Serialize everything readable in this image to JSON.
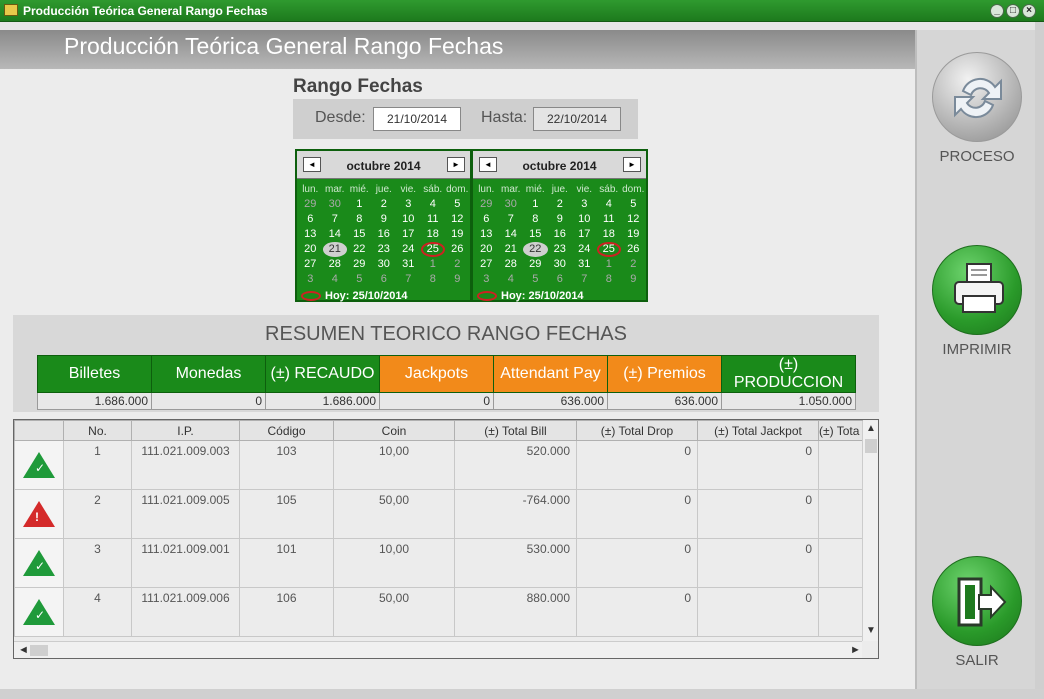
{
  "window": {
    "title": "Producción Teórica General Rango Fechas",
    "controls": [
      "_",
      "□",
      "×"
    ]
  },
  "header": {
    "title": "Producción Teórica General Rango Fechas"
  },
  "rango": {
    "title": "Rango Fechas",
    "desde_label": "Desde:",
    "desde_value": "21/10/2014",
    "hasta_label": "Hasta:",
    "hasta_value": "22/10/2014"
  },
  "calendars": [
    {
      "month": "octubre 2014",
      "prev": "◄",
      "next": "►",
      "day_headers": [
        "lun.",
        "mar.",
        "mié.",
        "jue.",
        "vie.",
        "sáb.",
        "dom."
      ],
      "weeks": [
        [
          "29",
          "30",
          "1",
          "2",
          "3",
          "4",
          "5"
        ],
        [
          "6",
          "7",
          "8",
          "9",
          "10",
          "11",
          "12"
        ],
        [
          "13",
          "14",
          "15",
          "16",
          "17",
          "18",
          "19"
        ],
        [
          "20",
          "21",
          "22",
          "23",
          "24",
          "25",
          "26"
        ],
        [
          "27",
          "28",
          "29",
          "30",
          "31",
          "1",
          "2"
        ],
        [
          "3",
          "4",
          "5",
          "6",
          "7",
          "8",
          "9"
        ]
      ],
      "selected": "21",
      "today_ring": "25",
      "footer": "Hoy: 25/10/2014"
    },
    {
      "month": "octubre 2014",
      "prev": "◄",
      "next": "►",
      "day_headers": [
        "lun.",
        "mar.",
        "mié.",
        "jue.",
        "vie.",
        "sáb.",
        "dom."
      ],
      "weeks": [
        [
          "29",
          "30",
          "1",
          "2",
          "3",
          "4",
          "5"
        ],
        [
          "6",
          "7",
          "8",
          "9",
          "10",
          "11",
          "12"
        ],
        [
          "13",
          "14",
          "15",
          "16",
          "17",
          "18",
          "19"
        ],
        [
          "20",
          "21",
          "22",
          "23",
          "24",
          "25",
          "26"
        ],
        [
          "27",
          "28",
          "29",
          "30",
          "31",
          "1",
          "2"
        ],
        [
          "3",
          "4",
          "5",
          "6",
          "7",
          "8",
          "9"
        ]
      ],
      "selected": "22",
      "today_ring": "25",
      "footer": "Hoy: 25/10/2014"
    }
  ],
  "resumen": {
    "title": "RESUMEN TEORICO RANGO FECHAS",
    "columns": [
      {
        "label": "Billetes",
        "value": "1.686.000",
        "accent": "#1a8a1a"
      },
      {
        "label": "Monedas",
        "value": "0",
        "accent": "#1a8a1a"
      },
      {
        "label": "(±) RECAUDO",
        "value": "1.686.000",
        "accent": "#1a8a1a"
      },
      {
        "label": "Jackpots",
        "value": "0",
        "accent": "#f28a1a"
      },
      {
        "label": "Attendant Pay",
        "value": "636.000",
        "accent": "#f28a1a"
      },
      {
        "label": "(±) Premios",
        "value": "636.000",
        "accent": "#f28a1a"
      },
      {
        "label": "(±) PRODUCCION",
        "value": "1.050.000",
        "accent": "#1a8a1a"
      }
    ]
  },
  "grid": {
    "columns": [
      "",
      "No.",
      "I.P.",
      "Código",
      "Coin",
      "(±) Total Bill",
      "(±) Total Drop",
      "(±) Total Jackpot",
      "(±) Tota"
    ],
    "rows": [
      {
        "status": "ok",
        "no": "1",
        "ip": "111.021.009.003",
        "codigo": "103",
        "coin": "10,00",
        "total_bill": "520.000",
        "total_drop": "0",
        "total_jackpot": "0"
      },
      {
        "status": "alert",
        "no": "2",
        "ip": "111.021.009.005",
        "codigo": "105",
        "coin": "50,00",
        "total_bill": "-764.000",
        "total_drop": "0",
        "total_jackpot": "0"
      },
      {
        "status": "ok",
        "no": "3",
        "ip": "111.021.009.001",
        "codigo": "101",
        "coin": "10,00",
        "total_bill": "530.000",
        "total_drop": "0",
        "total_jackpot": "0"
      },
      {
        "status": "ok",
        "no": "4",
        "ip": "111.021.009.006",
        "codigo": "106",
        "coin": "50,00",
        "total_bill": "880.000",
        "total_drop": "0",
        "total_jackpot": "0"
      }
    ]
  },
  "actions": {
    "proceso": "PROCESO",
    "imprimir": "IMPRIMIR",
    "salir": "SALIR"
  },
  "colors": {
    "green": "#1a8a1a",
    "orange": "#f28a1a",
    "ok_icon": "#1f9a3a",
    "alert_icon": "#d42a2a"
  }
}
